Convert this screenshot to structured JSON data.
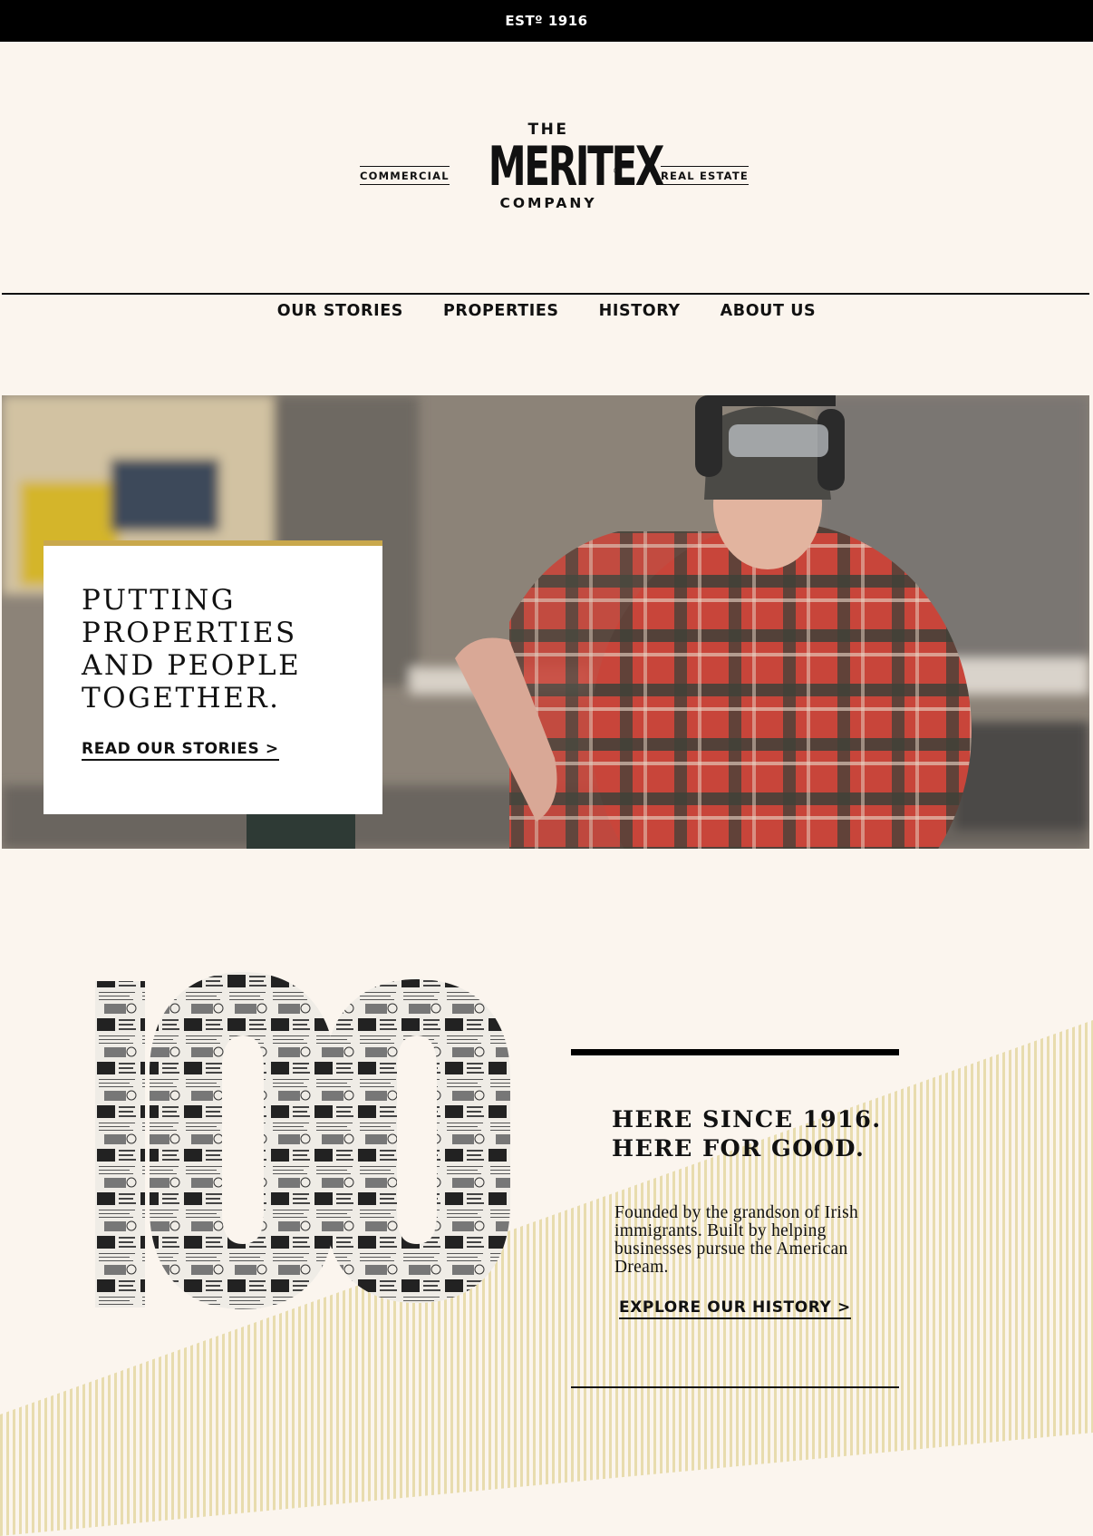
{
  "topbar": {
    "text": "ESTº 1916"
  },
  "logo": {
    "left_label": "COMMERCIAL",
    "the": "THE",
    "name": "MERITEX",
    "reg": "®",
    "company": "COMPANY",
    "right_label": "REAL ESTATE"
  },
  "nav": {
    "items": [
      {
        "label": "OUR STORIES"
      },
      {
        "label": "PROPERTIES"
      },
      {
        "label": "HISTORY"
      },
      {
        "label": "ABOUT US"
      }
    ]
  },
  "hero": {
    "title_lines": [
      "PUTTING",
      "PROPERTIES",
      "AND PEOPLE",
      "TOGETHER."
    ],
    "link": "READ OUR STORIES >",
    "accent_color": "#c9a84c"
  },
  "history": {
    "big_number": "100",
    "heading_lines": [
      "HERE SINCE 1916.",
      "HERE FOR GOOD."
    ],
    "body": "Founded by the grandson of Irish immigrants. Built by helping businesses pursue the American Dream.",
    "link": "EXPLORE OUR HISTORY >",
    "stripe_color": "#e8dcae"
  },
  "colors": {
    "background": "#fbf5ee",
    "text": "#111111"
  }
}
